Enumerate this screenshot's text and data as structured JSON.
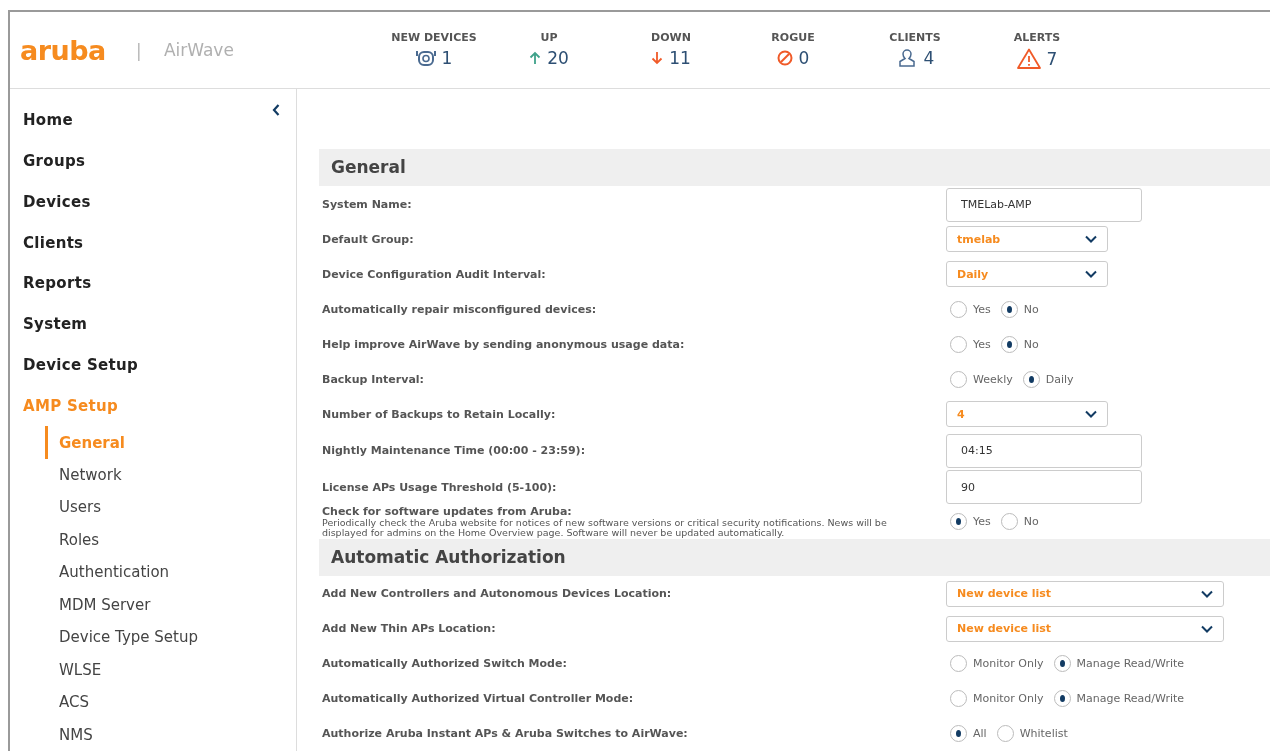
{
  "header": {
    "logo": "aruba",
    "product": "AirWave",
    "separator": "|",
    "stats": [
      {
        "kind": "new",
        "label": "NEW DEVICES",
        "value": "1"
      },
      {
        "kind": "up",
        "label": "UP",
        "value": "20"
      },
      {
        "kind": "down",
        "label": "DOWN",
        "value": "11"
      },
      {
        "kind": "rogue",
        "label": "ROGUE",
        "value": "0"
      },
      {
        "kind": "clients",
        "label": "CLIENTS",
        "value": "4"
      },
      {
        "kind": "alerts",
        "label": "ALERTS",
        "value": "7"
      }
    ]
  },
  "sidebar": {
    "items": [
      {
        "label": "Home",
        "selected": false
      },
      {
        "label": "Groups",
        "selected": false
      },
      {
        "label": "Devices",
        "selected": false
      },
      {
        "label": "Clients",
        "selected": false
      },
      {
        "label": "Reports",
        "selected": false
      },
      {
        "label": "System",
        "selected": false
      },
      {
        "label": "Device Setup",
        "selected": false
      },
      {
        "label": "AMP Setup",
        "selected": true,
        "children": [
          {
            "label": "General",
            "selected": true
          },
          {
            "label": "Network",
            "selected": false
          },
          {
            "label": "Users",
            "selected": false
          },
          {
            "label": "Roles",
            "selected": false
          },
          {
            "label": "Authentication",
            "selected": false
          },
          {
            "label": "MDM Server",
            "selected": false
          },
          {
            "label": "Device Type Setup",
            "selected": false
          },
          {
            "label": "WLSE",
            "selected": false
          },
          {
            "label": "ACS",
            "selected": false
          },
          {
            "label": "NMS",
            "selected": false
          }
        ]
      }
    ]
  },
  "sections": [
    {
      "title": "General",
      "rows": [
        {
          "label": "System Name:",
          "kind": "text",
          "value": "TMELab-AMP"
        },
        {
          "label": "Default Group:",
          "kind": "select",
          "value": "tmelab",
          "wide": false
        },
        {
          "label": "Device Configuration Audit Interval:",
          "kind": "select",
          "value": "Daily",
          "wide": false
        },
        {
          "label": "Automatically repair misconfigured devices:",
          "kind": "radio",
          "options": [
            {
              "label": "Yes",
              "selected": false
            },
            {
              "label": "No",
              "selected": true
            }
          ]
        },
        {
          "label": "Help improve AirWave by sending anonymous usage data:",
          "kind": "radio",
          "options": [
            {
              "label": "Yes",
              "selected": false
            },
            {
              "label": "No",
              "selected": true
            }
          ]
        },
        {
          "label": "Backup Interval:",
          "kind": "radio",
          "options": [
            {
              "label": "Weekly",
              "selected": false
            },
            {
              "label": "Daily",
              "selected": true
            }
          ]
        },
        {
          "label": "Number of Backups to Retain Locally:",
          "kind": "select",
          "value": "4",
          "wide": false
        },
        {
          "label": "Nightly Maintenance Time (00:00 - 23:59):",
          "kind": "text",
          "value": "04:15"
        },
        {
          "label": "License APs Usage Threshold (5-100):",
          "kind": "text",
          "value": "90"
        },
        {
          "label": "Check for software updates from Aruba:",
          "description": "Periodically check the Aruba website for notices of new software versions or critical security notifications. News will be displayed for admins on the Home Overview page. Software will never be updated automatically.",
          "kind": "radio",
          "options": [
            {
              "label": "Yes",
              "selected": true
            },
            {
              "label": "No",
              "selected": false
            }
          ]
        }
      ]
    },
    {
      "title": "Automatic Authorization",
      "rows": [
        {
          "label": "Add New Controllers and Autonomous Devices Location:",
          "kind": "select",
          "value": "New device list",
          "wide": true
        },
        {
          "label": "Add New Thin APs Location:",
          "kind": "select",
          "value": "New device list",
          "wide": true
        },
        {
          "label": "Automatically Authorized Switch Mode:",
          "kind": "radio",
          "options": [
            {
              "label": "Monitor Only",
              "selected": false
            },
            {
              "label": "Manage Read/Write",
              "selected": true
            }
          ]
        },
        {
          "label": "Automatically Authorized Virtual Controller Mode:",
          "kind": "radio",
          "options": [
            {
              "label": "Monitor Only",
              "selected": false
            },
            {
              "label": "Manage Read/Write",
              "selected": true
            }
          ]
        },
        {
          "label": "Authorize Aruba Instant APs & Aruba Switches to AirWave:",
          "kind": "radio",
          "options": [
            {
              "label": "All",
              "selected": true
            },
            {
              "label": "Whitelist",
              "selected": false
            }
          ]
        }
      ]
    }
  ]
}
